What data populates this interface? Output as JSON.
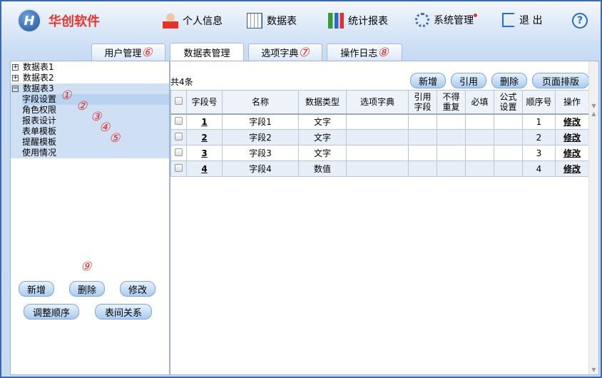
{
  "brand": {
    "logo_text": "H",
    "name": "华创软件"
  },
  "nav": [
    {
      "label": "个人信息"
    },
    {
      "label": "数据表"
    },
    {
      "label": "统计报表"
    },
    {
      "label": "系统管理"
    },
    {
      "label": "退 出"
    }
  ],
  "help": "?",
  "tabs": [
    {
      "label": "用户管理",
      "mark": "⑥"
    },
    {
      "label": "数据表管理"
    },
    {
      "label": "选项字典",
      "mark": "⑦"
    },
    {
      "label": "操作日志",
      "mark": "⑧"
    }
  ],
  "tree": {
    "nodes": [
      {
        "label": "数据表1",
        "toggle": "+"
      },
      {
        "label": "数据表2",
        "toggle": "+"
      },
      {
        "label": "数据表3",
        "toggle": "−"
      }
    ],
    "children": [
      {
        "label": "字段设置",
        "mark": "①"
      },
      {
        "label": "角色权限",
        "mark": "②"
      },
      {
        "label": "报表设计",
        "mark": "③"
      },
      {
        "label": "表单模板",
        "mark": "④"
      },
      {
        "label": "提醒模板",
        "mark": "⑤"
      },
      {
        "label": "使用情况"
      }
    ]
  },
  "left_buttons": {
    "add": "新增",
    "delete": "删除",
    "edit": "修改",
    "reorder": "调整顺序",
    "relations": "表间关系",
    "mark": "⑨"
  },
  "main": {
    "count": "共4条",
    "buttons": {
      "add": "新增",
      "ref": "引用",
      "delete": "删除",
      "layout": "页面排版"
    },
    "headers": [
      "字段号",
      "名称",
      "数据类型",
      "选项字典",
      "引用字段",
      "不得重复",
      "必填",
      "公式设置",
      "顺序号",
      "操作"
    ],
    "rows": [
      {
        "no": "1",
        "name": "字段1",
        "type": "文字",
        "dict": "",
        "order": "1",
        "action": "修改"
      },
      {
        "no": "2",
        "name": "字段2",
        "type": "文字",
        "dict": "",
        "order": "2",
        "action": "修改"
      },
      {
        "no": "3",
        "name": "字段3",
        "type": "文字",
        "dict": "",
        "order": "3",
        "action": "修改"
      },
      {
        "no": "4",
        "name": "字段4",
        "type": "数值",
        "dict": "",
        "order": "4",
        "action": "修改"
      }
    ]
  }
}
